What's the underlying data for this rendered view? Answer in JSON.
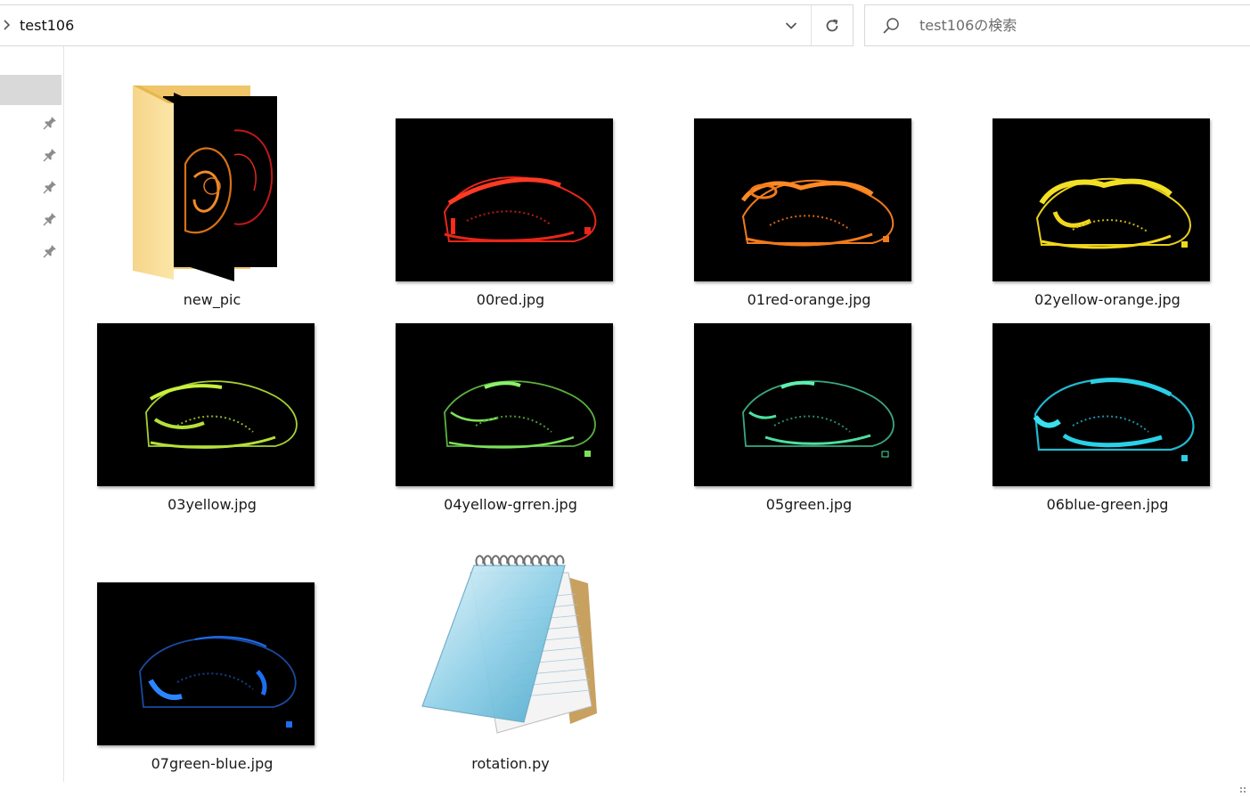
{
  "address": {
    "path": "test106"
  },
  "search": {
    "placeholder": "test106の検索"
  },
  "items": [
    {
      "name": "new_pic",
      "type": "folder"
    },
    {
      "name": "00red.jpg",
      "type": "image",
      "color": "#e8261a"
    },
    {
      "name": "01red-orange.jpg",
      "type": "image",
      "color": "#f07a1c"
    },
    {
      "name": "02yellow-orange.jpg",
      "type": "image",
      "color": "#f2d81c"
    },
    {
      "name": "03yellow.jpg",
      "type": "image",
      "color": "#b6e03a"
    },
    {
      "name": "04yellow-grren.jpg",
      "type": "image",
      "color": "#7ee05a"
    },
    {
      "name": "05green.jpg",
      "type": "image",
      "color": "#4ee0a0"
    },
    {
      "name": "06blue-green.jpg",
      "type": "image",
      "color": "#2ad0e6"
    },
    {
      "name": "07green-blue.jpg",
      "type": "image",
      "color": "#1e6ef0"
    },
    {
      "name": "rotation.py",
      "type": "script"
    }
  ]
}
